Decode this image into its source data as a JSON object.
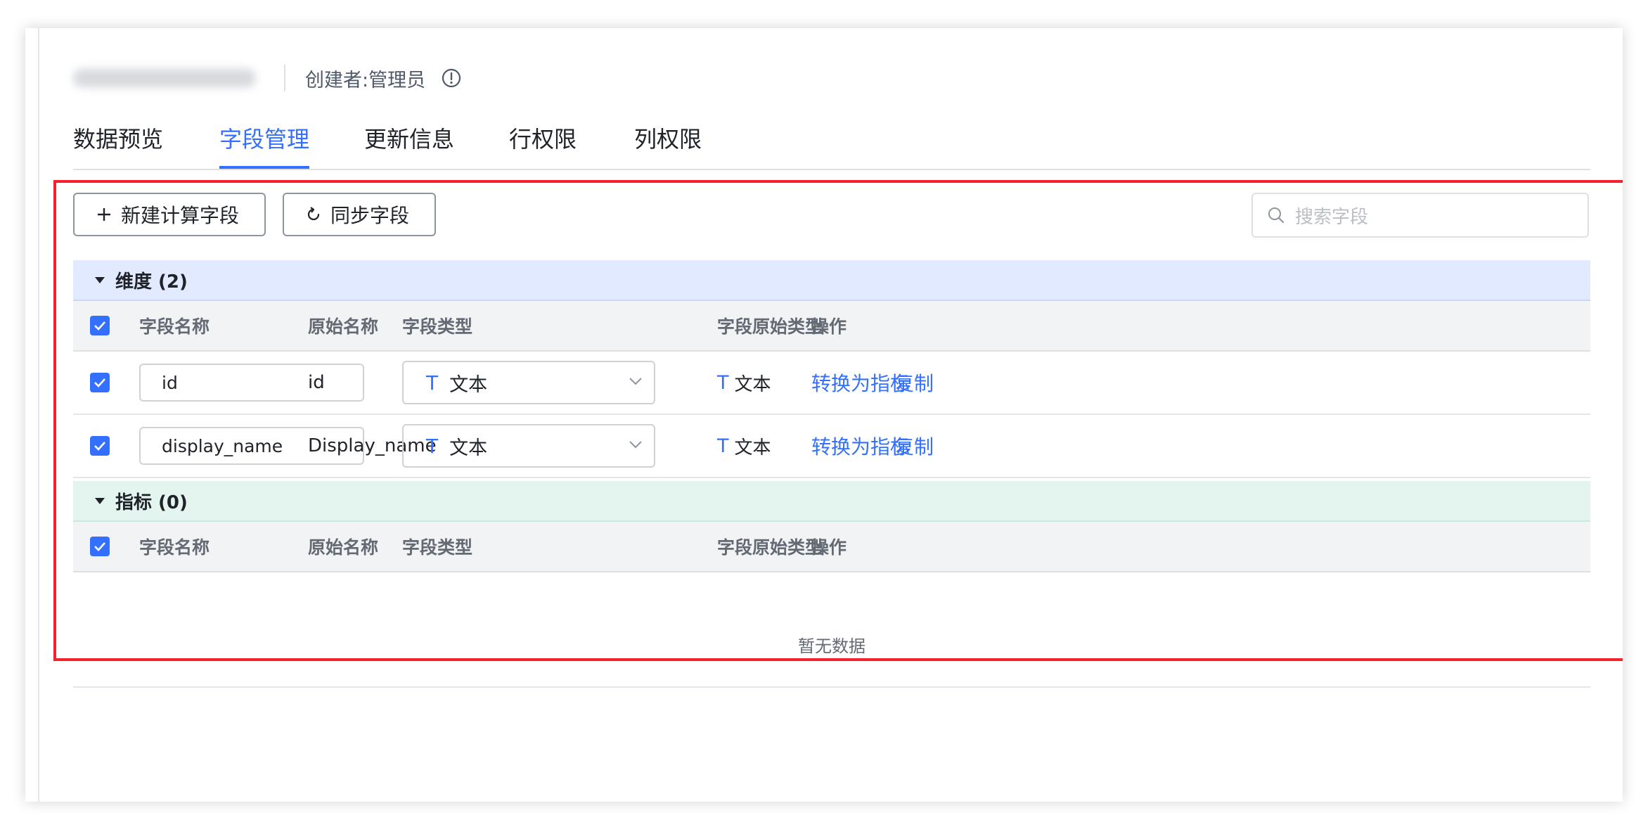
{
  "header": {
    "creator_label": "创建者:管理员",
    "info_icon": "info-circle-icon"
  },
  "tabs": [
    {
      "label": "数据预览",
      "active": false
    },
    {
      "label": "字段管理",
      "active": true
    },
    {
      "label": "更新信息",
      "active": false
    },
    {
      "label": "行权限",
      "active": false
    },
    {
      "label": "列权限",
      "active": false
    }
  ],
  "toolbar": {
    "new_calc_field_label": "新建计算字段",
    "sync_fields_label": "同步字段",
    "search_placeholder": "搜索字段"
  },
  "columns": {
    "field_name": "字段名称",
    "original_name": "原始名称",
    "field_type": "字段类型",
    "original_type": "字段原始类型",
    "actions": "操作"
  },
  "dimensions": {
    "title": "维度 (2)",
    "rows": [
      {
        "field_name": "id",
        "original_name": "id",
        "type_icon": "T",
        "field_type": "文本",
        "original_type_icon": "T",
        "original_type": "文本",
        "action_convert": "转换为指标",
        "action_copy": "复制",
        "checked": true
      },
      {
        "field_name": "display_name",
        "original_name": "Display_name",
        "type_icon": "T",
        "field_type": "文本",
        "original_type_icon": "T",
        "original_type": "文本",
        "action_convert": "转换为指标",
        "action_copy": "复制",
        "checked": true
      }
    ]
  },
  "metrics": {
    "title": "指标 (0)",
    "empty_text": "暂无数据"
  },
  "colors": {
    "accent": "#3370ff",
    "highlight_border": "#f5222d",
    "dimension_header_bg": "#e1eaff",
    "metric_header_bg": "#e4f5f0"
  }
}
